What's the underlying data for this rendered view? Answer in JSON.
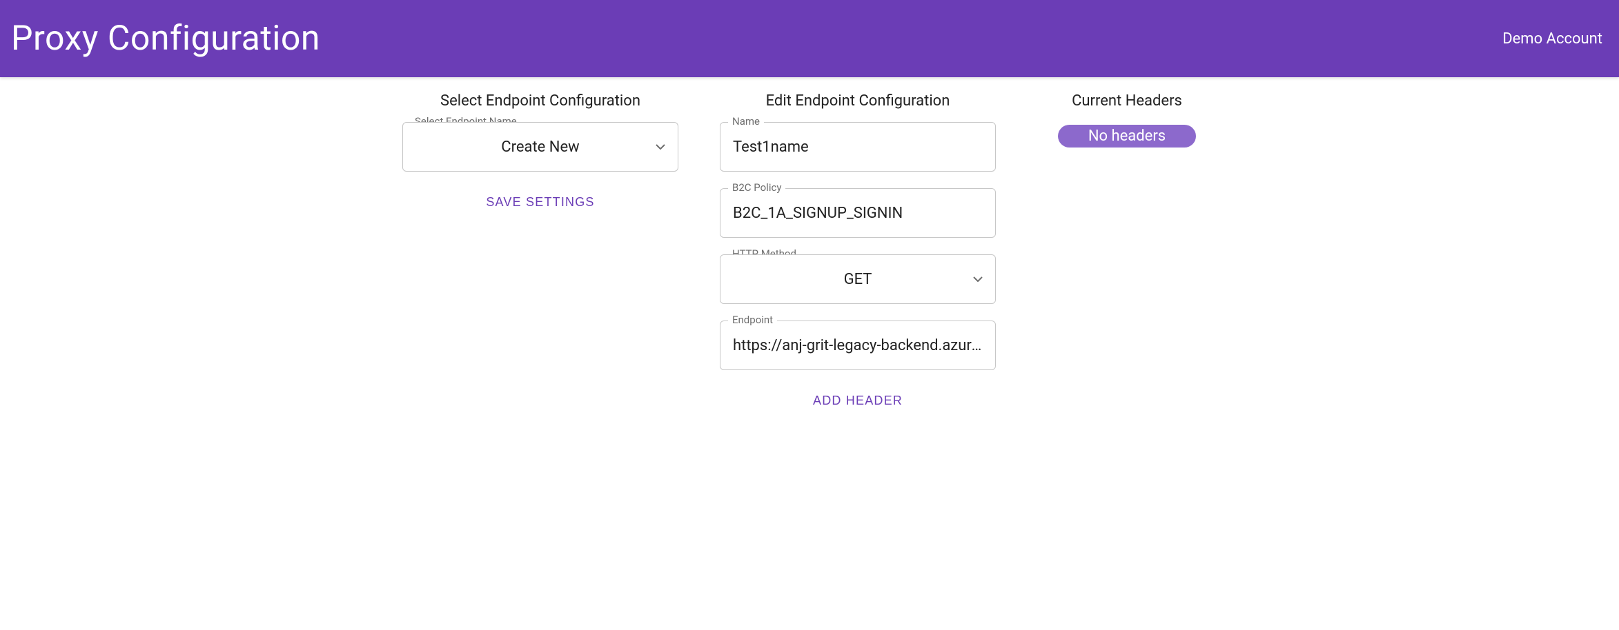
{
  "header": {
    "title": "Proxy Configuration",
    "account_label": "Demo Account"
  },
  "left": {
    "title": "Select Endpoint Configuration",
    "select_label": "Select Endpoint Name",
    "select_value": "Create New",
    "save_button": "SAVE SETTINGS"
  },
  "mid": {
    "title": "Edit Endpoint Configuration",
    "name_label": "Name",
    "name_value": "Test1name",
    "b2c_label": "B2C Policy",
    "b2c_value": "B2C_1A_SIGNUP_SIGNIN",
    "http_label": "HTTP Method",
    "http_value": "GET",
    "endpoint_label": "Endpoint",
    "endpoint_value": "https://anj-grit-legacy-backend.azurew",
    "add_header_button": "ADD HEADER"
  },
  "right": {
    "title": "Current Headers",
    "chip": "No headers"
  }
}
